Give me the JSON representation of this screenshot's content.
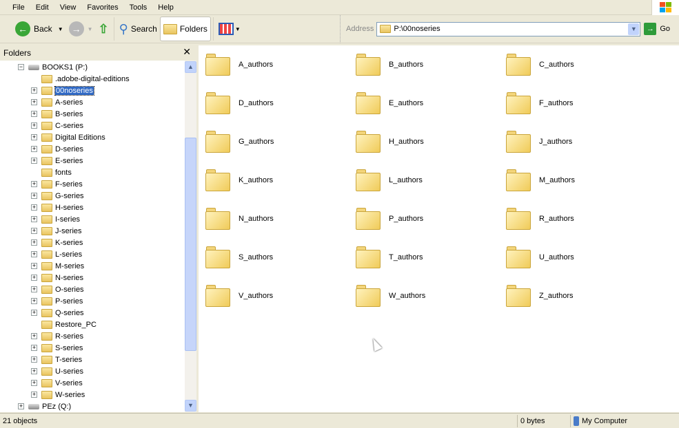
{
  "menu": [
    "File",
    "Edit",
    "View",
    "Favorites",
    "Tools",
    "Help"
  ],
  "toolbar": {
    "back": "Back",
    "search": "Search",
    "folders": "Folders"
  },
  "address": {
    "label": "Address",
    "value": "P:\\00noseries",
    "go": "Go"
  },
  "folders_pane": {
    "title": "Folders",
    "close": "✕"
  },
  "tree": {
    "root": "BOOKS1 (P:)",
    "children": [
      {
        "label": ".adobe-digital-editions",
        "expandable": false
      },
      {
        "label": "00noseries",
        "expandable": true,
        "selected": true
      },
      {
        "label": "A-series",
        "expandable": true
      },
      {
        "label": "B-series",
        "expandable": true
      },
      {
        "label": "C-series",
        "expandable": true
      },
      {
        "label": "Digital Editions",
        "expandable": true
      },
      {
        "label": "D-series",
        "expandable": true
      },
      {
        "label": "E-series",
        "expandable": true
      },
      {
        "label": "fonts",
        "expandable": false
      },
      {
        "label": "F-series",
        "expandable": true
      },
      {
        "label": "G-series",
        "expandable": true
      },
      {
        "label": "H-series",
        "expandable": true
      },
      {
        "label": "I-series",
        "expandable": true
      },
      {
        "label": "J-series",
        "expandable": true
      },
      {
        "label": "K-series",
        "expandable": true
      },
      {
        "label": "L-series",
        "expandable": true
      },
      {
        "label": "M-series",
        "expandable": true
      },
      {
        "label": "N-series",
        "expandable": true
      },
      {
        "label": "O-series",
        "expandable": true
      },
      {
        "label": "P-series",
        "expandable": true
      },
      {
        "label": "Q-series",
        "expandable": true
      },
      {
        "label": "Restore_PC",
        "expandable": false
      },
      {
        "label": "R-series",
        "expandable": true
      },
      {
        "label": "S-series",
        "expandable": true
      },
      {
        "label": "T-series",
        "expandable": true
      },
      {
        "label": "U-series",
        "expandable": true
      },
      {
        "label": "V-series",
        "expandable": true
      },
      {
        "label": "W-series",
        "expandable": true
      }
    ],
    "next_drive": "PEz (Q:)"
  },
  "items": [
    "A_authors",
    "B_authors",
    "C_authors",
    "D_authors",
    "E_authors",
    "F_authors",
    "G_authors",
    "H_authors",
    "J_authors",
    "K_authors",
    "L_authors",
    "M_authors",
    "N_authors",
    "P_authors",
    "R_authors",
    "S_authors",
    "T_authors",
    "U_authors",
    "V_authors",
    "W_authors",
    "Z_authors"
  ],
  "status": {
    "objects": "21 objects",
    "size": "0 bytes",
    "zone": "My Computer"
  }
}
